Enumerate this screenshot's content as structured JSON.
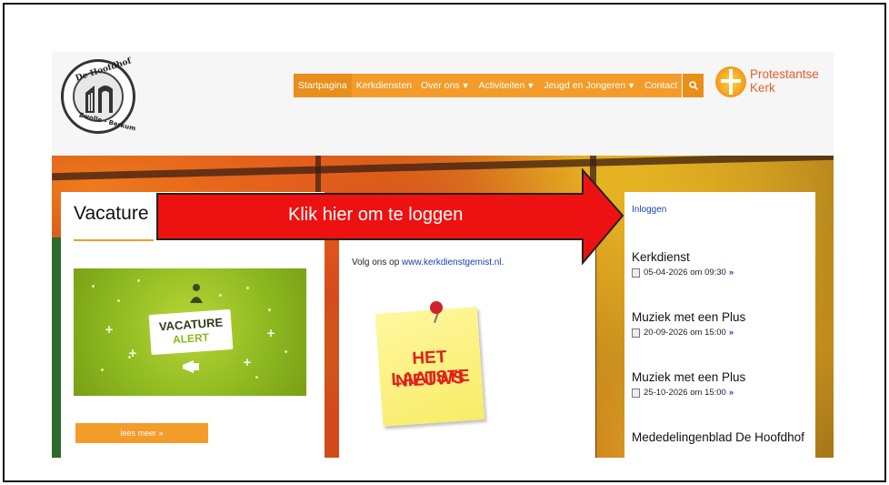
{
  "header": {
    "logo": {
      "top_text": "De Hoofdhof",
      "bottom_text": "Zwolle - Berkum"
    },
    "nav": [
      {
        "label": "Startpagina",
        "active": true,
        "dropdown": false
      },
      {
        "label": "Kerkdiensten",
        "active": false,
        "dropdown": false
      },
      {
        "label": "Over ons",
        "active": false,
        "dropdown": true
      },
      {
        "label": "Activiteiten",
        "active": false,
        "dropdown": true
      },
      {
        "label": "Jeugd en Jongeren",
        "active": false,
        "dropdown": true
      },
      {
        "label": "Contact",
        "active": false,
        "dropdown": false
      }
    ],
    "search_icon": "search-icon",
    "pk_logo": {
      "line1": "Protestantse",
      "line2": "Kerk"
    }
  },
  "left_column": {
    "title": "Vacature",
    "banner": {
      "line1": "VACATURE",
      "line2": "ALERT"
    },
    "button_label": "lees meer »"
  },
  "middle_column": {
    "text_prefix": "Volg ons op ",
    "link_text": "www.kerkdienstgemist.nl",
    "text_suffix": ".",
    "note": {
      "line1": "HET LAATSTE",
      "line2": "NIEUWS"
    }
  },
  "right_column": {
    "login_label": "Inloggen",
    "events": [
      {
        "title": "Kerkdienst",
        "date": "05-04-2026 om 09:30"
      },
      {
        "title": "Muziek met een Plus",
        "date": "20-09-2026 om 15:00"
      },
      {
        "title": "Muziek met een Plus",
        "date": "25-10-2026 om 15:00"
      },
      {
        "title": "Mededelingenblad De Hoofdhof",
        "date": ""
      }
    ]
  },
  "annotation": {
    "arrow_text": "Klik hier om te loggen",
    "arrow_color": "#ee1111"
  },
  "colors": {
    "accent": "#f39c2a",
    "link": "#1a3fb0",
    "brand": "#e75d2b"
  }
}
